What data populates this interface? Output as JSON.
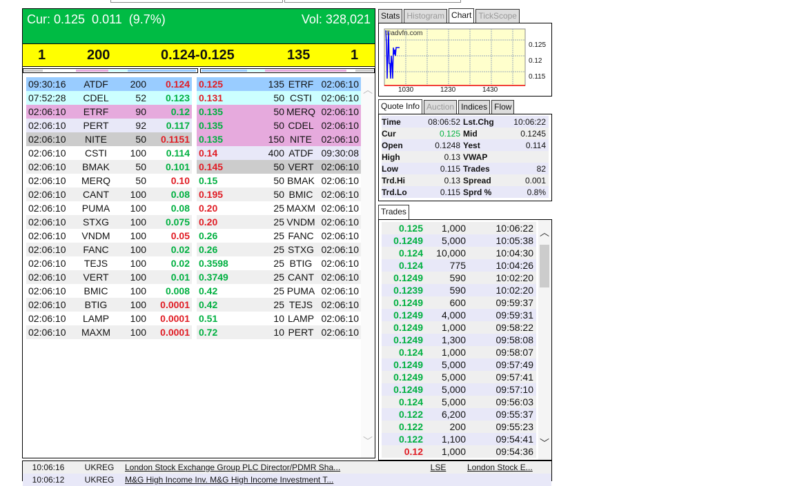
{
  "header": {
    "cur_label": "Cur: 0.125  0.011  (9.7%)",
    "vol_label": "Vol: 328,021"
  },
  "best": {
    "bid_count": "1",
    "bid_size": "200",
    "spread": "0.124-0.125",
    "ask_size": "135",
    "ask_count": "1"
  },
  "colors": {
    "blue": "#99ccff",
    "cyan": "#ccffff",
    "pink": "#e6aadd",
    "lavender": "#e8e8f8",
    "gray": "#cccccc",
    "light": "#efefef",
    "white": "#ffffff",
    "green": "#00bb44",
    "yellow": "#ffff00"
  },
  "bids": [
    [
      "09:30:16",
      "ATDF",
      "200",
      "0.124",
      "r",
      "blue"
    ],
    [
      "07:52:28",
      "CDEL",
      "52",
      "0.123",
      "g",
      "cyan"
    ],
    [
      "02:06:10",
      "ETRF",
      "90",
      "0.12",
      "g",
      "pink"
    ],
    [
      "02:06:10",
      "PERT",
      "92",
      "0.117",
      "g",
      "lavender"
    ],
    [
      "02:06:10",
      "NITE",
      "50",
      "0.1151",
      "r",
      "gray"
    ],
    [
      "02:06:10",
      "CSTI",
      "100",
      "0.114",
      "g",
      "white"
    ],
    [
      "02:06:10",
      "BMAK",
      "50",
      "0.101",
      "g",
      "light"
    ],
    [
      "02:06:10",
      "MERQ",
      "50",
      "0.10",
      "r",
      "white"
    ],
    [
      "02:06:10",
      "CANT",
      "100",
      "0.08",
      "g",
      "light"
    ],
    [
      "02:06:10",
      "PUMA",
      "100",
      "0.08",
      "g",
      "white"
    ],
    [
      "02:06:10",
      "STXG",
      "100",
      "0.075",
      "g",
      "light"
    ],
    [
      "02:06:10",
      "VNDM",
      "100",
      "0.05",
      "r",
      "white"
    ],
    [
      "02:06:10",
      "FANC",
      "100",
      "0.02",
      "g",
      "light"
    ],
    [
      "02:06:10",
      "TEJS",
      "100",
      "0.02",
      "g",
      "white"
    ],
    [
      "02:06:10",
      "VERT",
      "100",
      "0.01",
      "g",
      "light"
    ],
    [
      "02:06:10",
      "BMIC",
      "100",
      "0.008",
      "g",
      "white"
    ],
    [
      "02:06:10",
      "BTIG",
      "100",
      "0.0001",
      "r",
      "light"
    ],
    [
      "02:06:10",
      "LAMP",
      "100",
      "0.0001",
      "r",
      "white"
    ],
    [
      "02:06:10",
      "MAXM",
      "100",
      "0.0001",
      "r",
      "light"
    ]
  ],
  "asks": [
    [
      "0.125",
      "r",
      "135",
      "ETRF",
      "02:06:10",
      "blue"
    ],
    [
      "0.131",
      "r",
      "50",
      "CSTI",
      "02:06:10",
      "cyan"
    ],
    [
      "0.135",
      "g",
      "50",
      "MERQ",
      "02:06:10",
      "pink"
    ],
    [
      "0.135",
      "g",
      "50",
      "CDEL",
      "02:06:10",
      "pink"
    ],
    [
      "0.135",
      "g",
      "150",
      "NITE",
      "02:06:10",
      "pink"
    ],
    [
      "0.14",
      "r",
      "400",
      "ATDF",
      "09:30:08",
      "lavender"
    ],
    [
      "0.145",
      "r",
      "50",
      "VERT",
      "02:06:10",
      "gray"
    ],
    [
      "0.15",
      "g",
      "50",
      "BMAK",
      "02:06:10",
      "white"
    ],
    [
      "0.195",
      "r",
      "50",
      "BMIC",
      "02:06:10",
      "light"
    ],
    [
      "0.20",
      "r",
      "25",
      "MAXM",
      "02:06:10",
      "white"
    ],
    [
      "0.20",
      "r",
      "25",
      "VNDM",
      "02:06:10",
      "light"
    ],
    [
      "0.26",
      "g",
      "25",
      "FANC",
      "02:06:10",
      "white"
    ],
    [
      "0.26",
      "g",
      "25",
      "STXG",
      "02:06:10",
      "light"
    ],
    [
      "0.3598",
      "g",
      "25",
      "BTIG",
      "02:06:10",
      "white"
    ],
    [
      "0.3749",
      "g",
      "25",
      "CANT",
      "02:06:10",
      "light"
    ],
    [
      "0.42",
      "g",
      "25",
      "PUMA",
      "02:06:10",
      "white"
    ],
    [
      "0.42",
      "g",
      "25",
      "TEJS",
      "02:06:10",
      "light"
    ],
    [
      "0.51",
      "g",
      "10",
      "LAMP",
      "02:06:10",
      "white"
    ],
    [
      "0.72",
      "g",
      "10",
      "PERT",
      "02:06:10",
      "light"
    ]
  ],
  "chart_tabs": [
    "Stats",
    "Histogram",
    "Chart",
    "TickScope"
  ],
  "chart": {
    "watermark": "©advfn.com",
    "yticks": [
      "0.125",
      "0.12",
      "0.115"
    ],
    "xticks": [
      "1030",
      "1230",
      "1430"
    ]
  },
  "quote_tabs": [
    "Quote Info",
    "Auction",
    "Indices",
    "Flow"
  ],
  "quote": [
    [
      "Time",
      "08:06:52",
      "Lst.Chg",
      "10:06:22"
    ],
    [
      "Cur",
      "0.125",
      "Mid",
      "0.1245"
    ],
    [
      "Open",
      "0.1248",
      "Yest",
      "0.114"
    ],
    [
      "High",
      "0.13",
      "VWAP",
      ""
    ],
    [
      "Low",
      "0.115",
      "Trades",
      "82"
    ],
    [
      "Trd.Hi",
      "0.13",
      "Spread",
      "0.001"
    ],
    [
      "Trd.Lo",
      "0.115",
      "Sprd %",
      "0.8%"
    ]
  ],
  "trades_tab": "Trades",
  "trades": [
    [
      "0.125",
      "1,000",
      "10:06:22",
      "g"
    ],
    [
      "0.1249",
      "5,000",
      "10:05:38",
      "g"
    ],
    [
      "0.124",
      "10,000",
      "10:04:30",
      "g"
    ],
    [
      "0.124",
      "775",
      "10:04:26",
      "g"
    ],
    [
      "0.1249",
      "590",
      "10:02:20",
      "g"
    ],
    [
      "0.1239",
      "590",
      "10:02:20",
      "g"
    ],
    [
      "0.1249",
      "600",
      "09:59:37",
      "g"
    ],
    [
      "0.1249",
      "4,000",
      "09:59:31",
      "g"
    ],
    [
      "0.1249",
      "1,000",
      "09:58:22",
      "g"
    ],
    [
      "0.1249",
      "1,300",
      "09:58:08",
      "g"
    ],
    [
      "0.124",
      "1,000",
      "09:58:07",
      "g"
    ],
    [
      "0.1249",
      "5,000",
      "09:57:49",
      "g"
    ],
    [
      "0.1249",
      "5,000",
      "09:57:41",
      "g"
    ],
    [
      "0.1249",
      "5,000",
      "09:57:10",
      "g"
    ],
    [
      "0.124",
      "5,000",
      "09:56:03",
      "g"
    ],
    [
      "0.122",
      "6,200",
      "09:55:37",
      "g"
    ],
    [
      "0.122",
      "200",
      "09:55:23",
      "g"
    ],
    [
      "0.122",
      "1,100",
      "09:54:41",
      "g"
    ],
    [
      "0.12",
      "1,000",
      "09:54:36",
      "r"
    ]
  ],
  "news": [
    [
      "10:06:16",
      "UKREG",
      "London Stock Exchange Group PLC Director/PDMR Sha...",
      "LSE",
      "London Stock E..."
    ],
    [
      "10:06:12",
      "UKREG",
      "M&G High Income Inv. M&G High Income Investment T...",
      "",
      ""
    ]
  ]
}
